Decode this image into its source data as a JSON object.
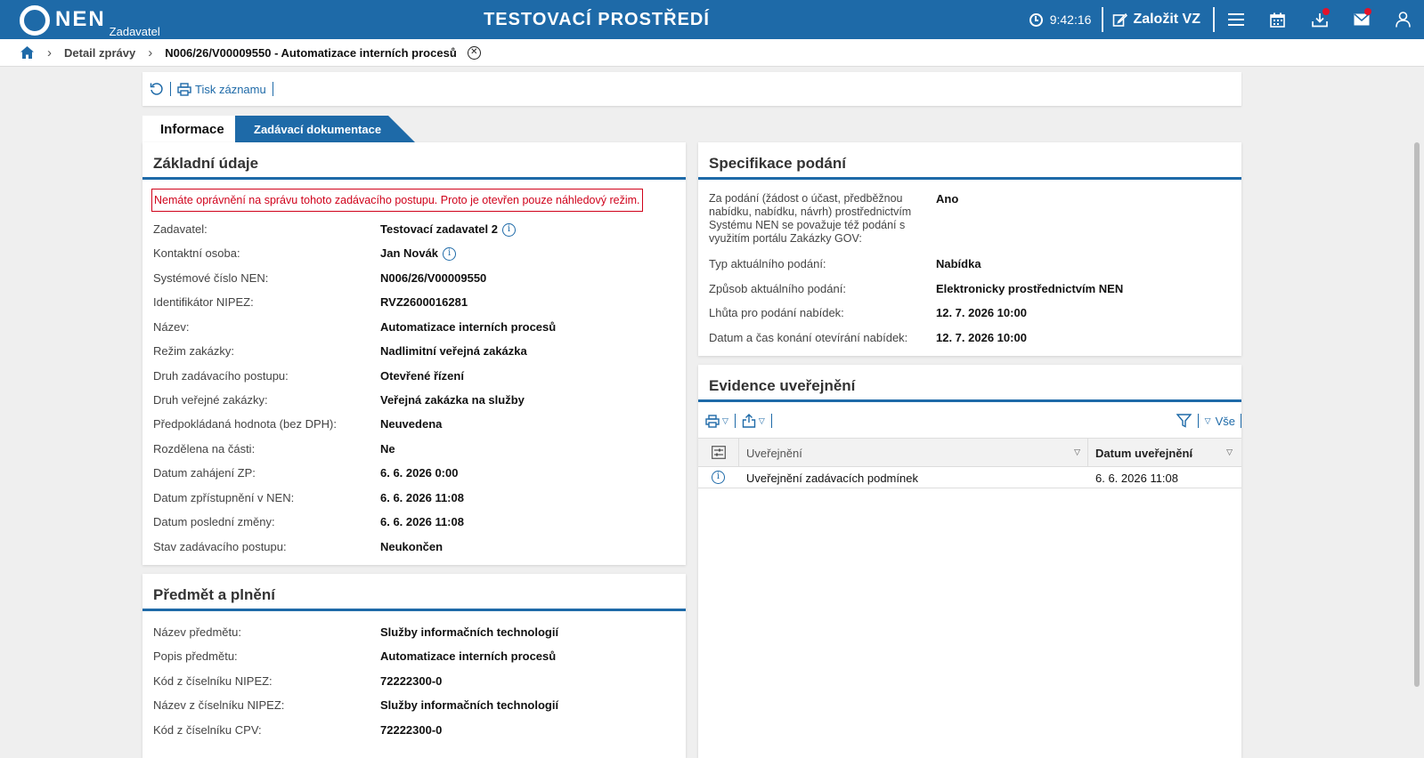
{
  "topbar": {
    "logo_text": "NEN",
    "logo_sub": "Zadavatel",
    "env_title": "TESTOVACÍ PROSTŘEDÍ",
    "time": "9:42:16",
    "new_vz_label": "Založit VZ"
  },
  "breadcrumb": {
    "item1": "Detail zprávy",
    "item2": "N006/26/V00009550 - Automatizace interních procesů"
  },
  "toolbar": {
    "print_label": "Tisk záznamu"
  },
  "tabs": {
    "info": "Informace",
    "docs": "Zadávací dokumentace"
  },
  "basic": {
    "title": "Základní údaje",
    "warning": "Nemáte oprávnění na správu tohoto zadávacího postupu. Proto je otevřen pouze náhledový režim.",
    "rows": [
      {
        "label": "Zadavatel:",
        "value": "Testovací zadavatel 2"
      },
      {
        "label": "Kontaktní osoba:",
        "value": "Jan Novák"
      },
      {
        "label": "Systémové číslo NEN:",
        "value": "N006/26/V00009550"
      },
      {
        "label": "Identifikátor NIPEZ:",
        "value": "RVZ2600016281"
      },
      {
        "label": "Název:",
        "value": "Automatizace interních procesů"
      },
      {
        "label": "Režim zakázky:",
        "value": "Nadlimitní veřejná zakázka"
      },
      {
        "label": "Druh zadávacího postupu:",
        "value": "Otevřené řízení"
      },
      {
        "label": "Druh veřejné zakázky:",
        "value": "Veřejná zakázka na služby"
      },
      {
        "label": "Předpokládaná hodnota (bez DPH):",
        "value": "Neuvedena"
      },
      {
        "label": "Rozdělena na části:",
        "value": "Ne"
      },
      {
        "label": "Datum zahájení ZP:",
        "value": "6. 6. 2026 0:00"
      },
      {
        "label": "Datum zpřístupnění v NEN:",
        "value": "6. 6. 2026 11:08"
      },
      {
        "label": "Datum poslední změny:",
        "value": "6. 6. 2026 11:08"
      },
      {
        "label": "Stav zadávacího postupu:",
        "value": "Neukončen"
      }
    ]
  },
  "subject": {
    "title": "Předmět a plnění",
    "rows": [
      {
        "label": "Název předmětu:",
        "value": "Služby informačních technologií"
      },
      {
        "label": "Popis předmětu:",
        "value": "Automatizace interních procesů"
      },
      {
        "label": "Kód z číselníku NIPEZ:",
        "value": "72222300-0"
      },
      {
        "label": "Název z číselníku NIPEZ:",
        "value": "Služby informačních technologií"
      },
      {
        "label": "Kód z číselníku CPV:",
        "value": "72222300-0"
      }
    ]
  },
  "spec": {
    "title": "Specifikace podání",
    "rows": [
      {
        "label_lines": [
          "Za podání (žádost o účast, předběžnou",
          "nabídku, nabídku, návrh) prostřednictvím",
          "Systému NEN se považuje též podání s",
          "využitím portálu Zakázky GOV:"
        ],
        "value": "Ano"
      },
      {
        "label": "Typ aktuálního podání:",
        "value": "Nabídka"
      },
      {
        "label": "Způsob aktuálního podání:",
        "value": "Elektronicky prostřednictvím NEN"
      },
      {
        "label": "Lhůta pro podání nabídek:",
        "value": "12. 7. 2026 10:00"
      },
      {
        "label": "Datum a čas konání otevírání nabídek:",
        "value": "12. 7. 2026 10:00"
      }
    ]
  },
  "publish": {
    "title": "Evidence uveřejnění",
    "filter_all": "Vše",
    "columns": [
      "Uveřejnění",
      "Datum uveřejnění"
    ],
    "rows": [
      {
        "name": "Uveřejnění zadávacích podmínek",
        "date": "6. 6. 2026 11:08"
      }
    ]
  },
  "colors": {
    "brand": "#1e6aa8",
    "warning": "#d0021b",
    "badge": "#e3122a"
  }
}
